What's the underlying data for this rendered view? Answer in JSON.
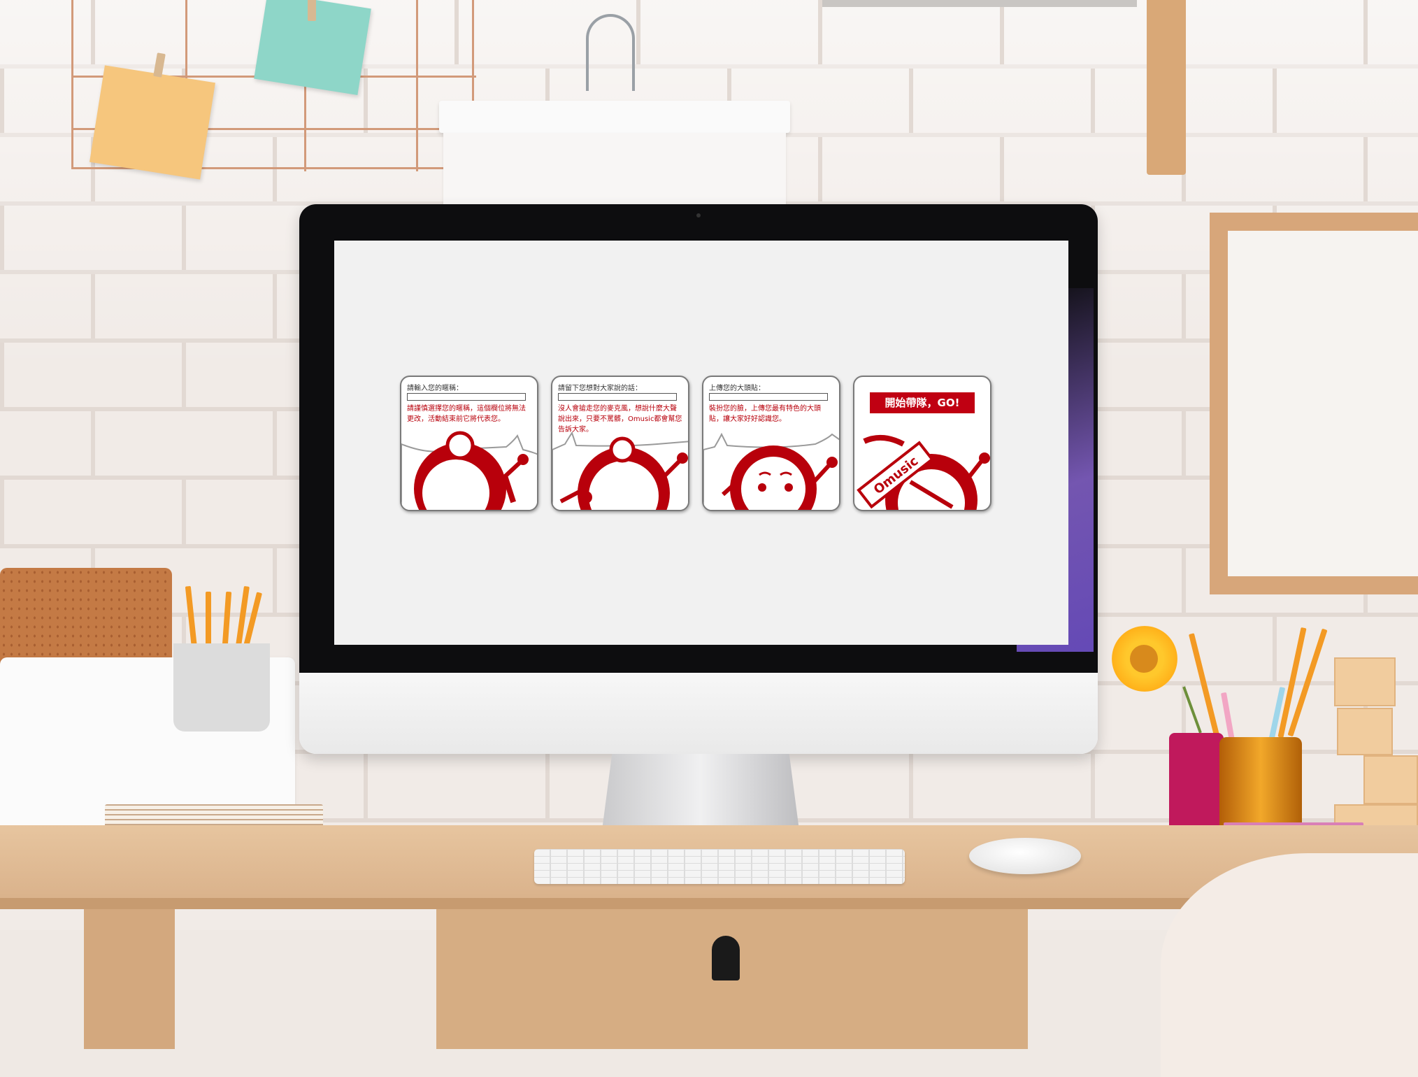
{
  "screen": {
    "cards": [
      {
        "prompt": "請輸入您的暱稱：",
        "description": "請謹慎選擇您的暱稱，這個欄位將無法更改，活動結束前它將代表您。",
        "icon": "drummer-character-icon"
      },
      {
        "prompt": "請留下您想對大家說的話：",
        "description": "沒人會搶走您的麥克風，想說什麼大聲說出來，只要不罵髒，Omusic都會幫您告訴大家。",
        "icon": "drummer-microphone-icon"
      },
      {
        "prompt": "上傳您的大頭貼：",
        "description": "裝扮您的臉，上傳您最有特色的大頭貼，讓大家好好認識您。",
        "icon": "drummer-face-icon"
      },
      {
        "button_label": "開始帶隊，GO!",
        "badge": "Omusic",
        "icon": "drummer-flag-icon"
      }
    ]
  },
  "colors": {
    "accent": "#c00012",
    "card_border": "#7a7a7a",
    "screen_bg": "#f1f1f1"
  }
}
